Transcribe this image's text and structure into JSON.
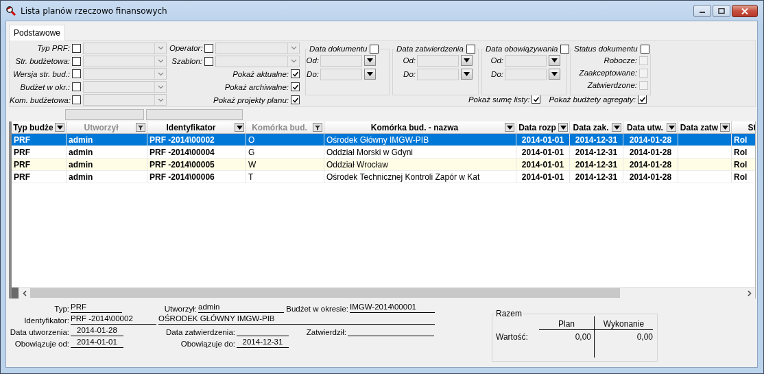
{
  "window": {
    "title": "Lista planów rzeczowo finansowych"
  },
  "tabs": [
    {
      "label": "Podstawowe",
      "selected": true
    }
  ],
  "filters": {
    "left": [
      {
        "label": "Typ PRF:",
        "checked": false
      },
      {
        "label": "Str. budżetowa:",
        "checked": false
      },
      {
        "label": "Wersja str. bud.:",
        "checked": false
      },
      {
        "label": "Budżet w okr.:",
        "checked": false
      },
      {
        "label": "Kom. budżetowa:",
        "checked": false
      }
    ],
    "middle": [
      {
        "label": "Operator:",
        "checked": false
      },
      {
        "label": "Szablon:",
        "checked": false
      }
    ],
    "options": [
      {
        "label": "Pokaż aktualne:",
        "checked": true
      },
      {
        "label": "Pokaż archiwalne:",
        "checked": true
      },
      {
        "label": "Pokaż projekty planu:",
        "checked": true
      }
    ],
    "date_groups": [
      {
        "title": "Data dokumentu",
        "checked": false,
        "from_label": "Od:",
        "to_label": "Do:"
      },
      {
        "title": "Data zatwierdzenia",
        "checked": false,
        "from_label": "Od:",
        "to_label": "Do:"
      },
      {
        "title": "Data obowiązywania",
        "checked": false,
        "from_label": "Od:",
        "to_label": "Do:"
      }
    ],
    "status": {
      "title": "Status dokumentu",
      "checked": false,
      "items": [
        {
          "label": "Robocze:",
          "checked": false,
          "disabled": true
        },
        {
          "label": "Zaakceptowane:",
          "checked": false,
          "disabled": true
        },
        {
          "label": "Zatwierdzone:",
          "checked": false,
          "disabled": true
        }
      ]
    },
    "bottom_options": [
      {
        "label": "Pokaż sumę listy:",
        "checked": true
      },
      {
        "label": "Pokaż budżety agregaty:",
        "checked": true
      }
    ]
  },
  "table": {
    "columns": [
      {
        "label": "Typ budże",
        "kind": "menu",
        "filter_box": false
      },
      {
        "label": "Utworzył",
        "kind": "filter",
        "filter_box": true
      },
      {
        "label": "Identyfikator",
        "kind": "menu",
        "filter_box": true
      },
      {
        "label": "Komórka bud.",
        "kind": "filter",
        "filter_box": false
      },
      {
        "label": "Komórka bud. - nazwa",
        "kind": "menu",
        "filter_box": false
      },
      {
        "label": "Data rozp",
        "kind": "menu",
        "filter_box": false
      },
      {
        "label": "Data zak.",
        "kind": "menu",
        "filter_box": false
      },
      {
        "label": "Data utw.",
        "kind": "menu",
        "filter_box": false
      },
      {
        "label": "Data zatw",
        "kind": "menu",
        "filter_box": false
      },
      {
        "label": "St",
        "kind": "plain",
        "filter_box": false
      }
    ],
    "rows": [
      {
        "selected": true,
        "highlighted": false,
        "cells": [
          "PRF",
          "admin",
          "PRF -2014\\00002",
          "O",
          "Ośrodek Główny IMGW-PIB",
          "2014-01-01",
          "2014-12-31",
          "2014-01-28",
          null,
          "Rol"
        ]
      },
      {
        "selected": false,
        "highlighted": false,
        "cells": [
          "PRF",
          "admin",
          "PRF -2014\\00004",
          "G",
          "Oddział Morski w Gdyni",
          "2014-01-01",
          "2014-12-31",
          "2014-01-28",
          null,
          "Rol"
        ]
      },
      {
        "selected": false,
        "highlighted": true,
        "cells": [
          "PRF",
          "admin",
          "PRF -2014\\00005",
          "W",
          "Oddział Wrocław",
          "2014-01-01",
          "2014-12-31",
          "2014-01-28",
          null,
          "Rol"
        ]
      },
      {
        "selected": false,
        "highlighted": false,
        "cells": [
          "PRF",
          "admin",
          "PRF -2014\\00006",
          "T",
          "Ośrodek Technicznej Kontroli Zapór w Kat",
          "2014-01-01",
          "2014-12-31",
          "2014-01-28",
          null,
          "Rol"
        ]
      }
    ]
  },
  "details": {
    "rows": [
      [
        {
          "label": "Typ:",
          "value": "PRF"
        },
        {
          "label": "Utworzył:",
          "value": "admin"
        },
        {
          "label": "Budżet w okresie:",
          "value": "IMGW-2014\\00001"
        }
      ],
      [
        {
          "label": "Identyfikator:",
          "value": "PRF -2014\\00002"
        },
        {
          "value": "OŚRODEK GŁÓWNY IMGW-PIB"
        }
      ],
      [
        {
          "label": "Data utworzenia:",
          "value": "2014-01-28"
        },
        {
          "label": "Data zatwierdzenia:"
        },
        {
          "label": "Zatwierdził:"
        }
      ],
      [
        {
          "label": "Obowiązuje od:",
          "value": "2014-01-01"
        },
        {
          "label": "Obowiązuje do:",
          "value": "2014-12-31"
        }
      ]
    ]
  },
  "totals": {
    "title": "Razem",
    "columns": [
      "Plan",
      "Wykonanie"
    ],
    "rows": [
      {
        "label": "Wartość:",
        "values": [
          "0,00",
          "0,00"
        ]
      }
    ]
  }
}
